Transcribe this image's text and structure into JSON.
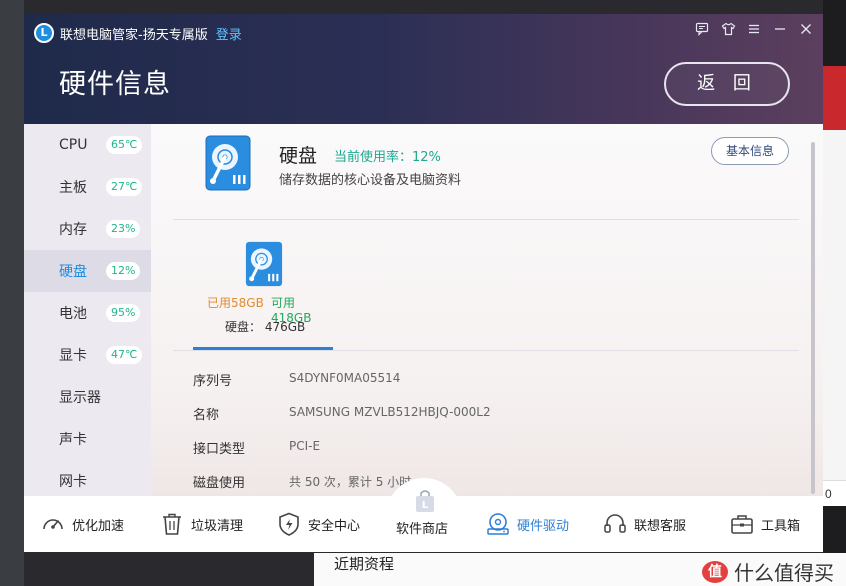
{
  "app": {
    "title": "联想电脑管家-扬天专属版",
    "login": "登录",
    "page_title": "硬件信息",
    "back_button": "返 回"
  },
  "sidebar": {
    "items": [
      {
        "label": "CPU",
        "badge": "65℃"
      },
      {
        "label": "主板",
        "badge": "27℃"
      },
      {
        "label": "内存",
        "badge": "23%"
      },
      {
        "label": "硬盘",
        "badge": "12%",
        "active": true
      },
      {
        "label": "电池",
        "badge": "95%"
      },
      {
        "label": "显卡",
        "badge": "47℃"
      },
      {
        "label": "显示器",
        "badge": ""
      },
      {
        "label": "声卡",
        "badge": ""
      },
      {
        "label": "网卡",
        "badge": ""
      }
    ]
  },
  "disk": {
    "title": "硬盘",
    "usage": "当前使用率：12%",
    "description": "储存数据的核心设备及电脑资料",
    "info_button": "基本信息",
    "used": "已用58GB",
    "free": "可用418GB",
    "capacity": "硬盘： 476GB",
    "properties": [
      {
        "key": "序列号",
        "value": "S4DYNF0MA05514"
      },
      {
        "key": "名称",
        "value": "SAMSUNG MZVLB512HBJQ-000L2"
      },
      {
        "key": "接口类型",
        "value": "PCI-E"
      },
      {
        "key": "磁盘使用",
        "value": "共 50 次，累计 5 小时"
      }
    ]
  },
  "bottom_nav": {
    "optimize": "优化加速",
    "cleanup": "垃圾清理",
    "security": "安全中心",
    "store": "软件商店",
    "driver": "硬件驱动",
    "service": "联想客服",
    "toolbox": "工具箱"
  },
  "background": {
    "bottom_text": "近期资程",
    "brand": "什么值得买",
    "brand_logo": "值",
    "right_chip": "0"
  },
  "colors": {
    "accent": "#2d7fd8",
    "badge_green": "#1fb58c",
    "used_orange": "#e38a2f",
    "free_green": "#1eaa5a"
  }
}
